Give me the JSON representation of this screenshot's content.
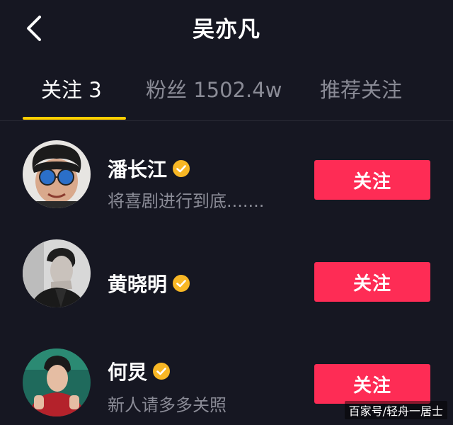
{
  "header": {
    "title": "吴亦凡",
    "back_icon": "chevron-left-icon"
  },
  "tabs": [
    {
      "label": "关注 3",
      "active": true
    },
    {
      "label": "粉丝 1502.4w",
      "active": false
    },
    {
      "label": "推荐关注",
      "active": false
    }
  ],
  "users": [
    {
      "name": "潘长江",
      "bio": "将喜剧进行到底.......",
      "verified": true,
      "follow_label": "关注"
    },
    {
      "name": "黄晓明",
      "bio": "",
      "verified": true,
      "follow_label": "关注"
    },
    {
      "name": "何炅",
      "bio": "新人请多多关照",
      "verified": true,
      "follow_label": "关注"
    }
  ],
  "watermark": "百家号/轻舟一居士",
  "colors": {
    "background": "#161722",
    "tab_indicator": "#fece00",
    "follow_button": "#fe2c55",
    "verified_badge": "#f8b725",
    "muted_text": "#8a8b96"
  }
}
